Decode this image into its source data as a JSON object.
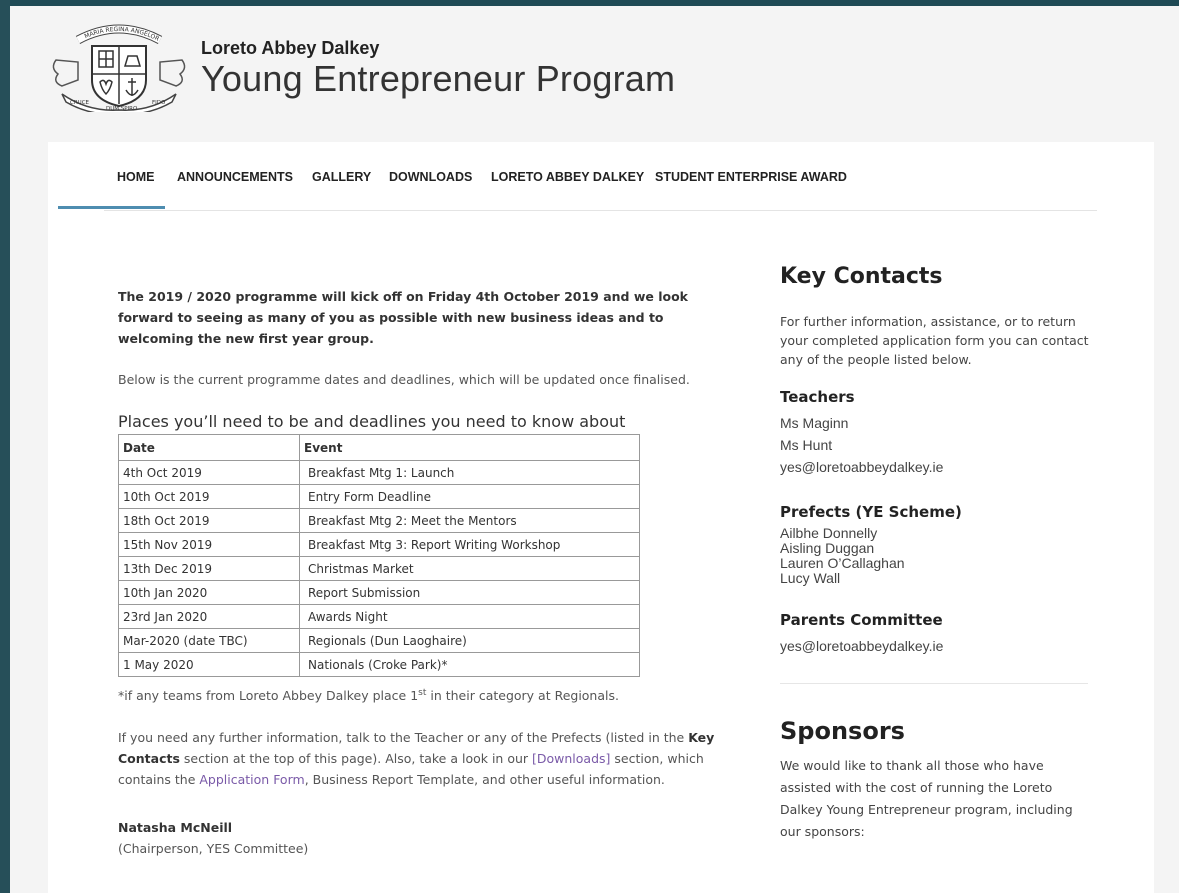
{
  "header": {
    "school_name": "Loreto Abbey Dalkey",
    "program_name": "Young Entrepreneur Program",
    "logo_mottos": [
      "MARIA REGINA ANGELORUM",
      "CRUCE",
      "DUM SPIRO",
      "FIDO"
    ]
  },
  "nav": {
    "items": [
      "HOME",
      "ANNOUNCEMENTS",
      "GALLERY",
      "DOWNLOADS",
      "LORETO ABBEY DALKEY",
      "STUDENT ENTERPRISE AWARD"
    ],
    "active": "HOME",
    "accent": "#4e8db0"
  },
  "main": {
    "intro": "The 2019 / 2020 programme will kick off on Friday 4th October 2019 and we look forward to seeing as many of you as possible with new business ideas and to welcoming the new first year group.",
    "below": "Below is the current programme dates and deadlines, which will be updated once finalised.",
    "section_title": "Places you’ll need to be and deadlines you need to know about",
    "table": {
      "headers": [
        "Date",
        "Event"
      ],
      "rows": [
        [
          "4th Oct 2019",
          "Breakfast Mtg 1:  Launch"
        ],
        [
          "10th Oct 2019",
          "Entry Form Deadline"
        ],
        [
          "18th Oct 2019",
          "Breakfast Mtg 2:  Meet the Mentors"
        ],
        [
          "15th Nov 2019",
          "Breakfast Mtg 3:  Report Writing Workshop"
        ],
        [
          "13th Dec 2019",
          "Christmas Market"
        ],
        [
          "10th Jan 2020",
          "Report Submission"
        ],
        [
          "23rd Jan 2020",
          "Awards Night"
        ],
        [
          "Mar-2020 (date TBC)",
          "Regionals (Dun Laoghaire)"
        ],
        [
          "1 May 2020",
          "Nationals (Croke Park)*"
        ]
      ]
    },
    "note_before": "*if any teams from Loreto Abbey Dalkey place 1",
    "note_sup": "st",
    "note_after": " in their category at Regionals.",
    "para_1": "If you need any further information, talk to the Teacher or any of the Prefects (listed in the ",
    "para_bold": "Key Contacts",
    "para_2": " section at the top of this page). Also, take a look in our ",
    "para_link_downloads": "[Downloads]",
    "para_3": " section, which contains the ",
    "para_link_form": "Application Form",
    "para_4": ",  Business Report Template, and other useful information.",
    "signature_name": "Natasha McNeill",
    "signature_role": "(Chairperson, YES Committee)",
    "link_color": "#7a5aa8"
  },
  "sidebar": {
    "key_title": "Key Contacts",
    "key_desc": "For further information, assistance, or to return your completed application form you can contact any of the people listed below.",
    "teachers_title": "Teachers",
    "teachers": [
      " Ms Maginn",
      " Ms Hunt"
    ],
    "teachers_email": "yes@loretoabbeydalkey.ie",
    "prefects_title": "Prefects (YE Scheme)",
    "prefects": [
      "Ailbhe Donnelly",
      "Aisling Duggan",
      "Lauren O’Callaghan",
      "Lucy Wall"
    ],
    "parents_title": "Parents Committee",
    "parents_email": "yes@loretoabbeydalkey.ie",
    "sponsors_title": "Sponsors",
    "sponsors_desc": "We would like to thank all those who have assisted with the cost of running the Loreto Dalkey Young Entrepreneur program, including our sponsors:"
  }
}
